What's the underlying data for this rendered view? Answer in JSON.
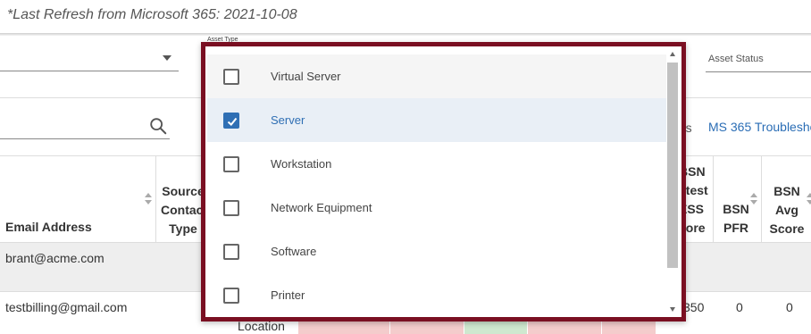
{
  "header": {
    "refresh_text": "*Last Refresh from Microsoft 365: 2021-10-08"
  },
  "filters": {
    "asset_type_label": "Asset Type",
    "asset_status_label": "Asset Status"
  },
  "toolbar": {
    "partial_text": "rs",
    "ms365_link": "MS 365 Troublesho"
  },
  "table": {
    "headers": {
      "email": "Email Address",
      "source_contact_type": [
        "Source",
        "Contact",
        "Type"
      ],
      "bsn_latest_score": [
        "BSN",
        "atest",
        "ESS",
        "core"
      ],
      "bsn_pfr": [
        "BSN",
        "PFR"
      ],
      "bsn_avg": [
        "BSN",
        "Avg",
        "Score"
      ]
    },
    "rows": [
      {
        "email": "brant@acme.com"
      },
      {
        "email": "testbilling@gmail.com",
        "partial_location": "Location",
        "bsn_latest": "350",
        "bsn_pfr": "0",
        "bsn_avg": "0"
      }
    ]
  },
  "dropdown": {
    "options": [
      {
        "label": "Virtual Server",
        "checked": false
      },
      {
        "label": "Server",
        "checked": true
      },
      {
        "label": "Workstation",
        "checked": false
      },
      {
        "label": "Network Equipment",
        "checked": false
      },
      {
        "label": "Software",
        "checked": false
      },
      {
        "label": "Printer",
        "checked": false
      }
    ]
  },
  "colors": {
    "highlight_outline": "#7a0f22",
    "checkbox_checked": "#2f6fb4",
    "link": "#2a6db5",
    "cell_red": "#f4cccc",
    "cell_green": "#cfe8cf"
  }
}
